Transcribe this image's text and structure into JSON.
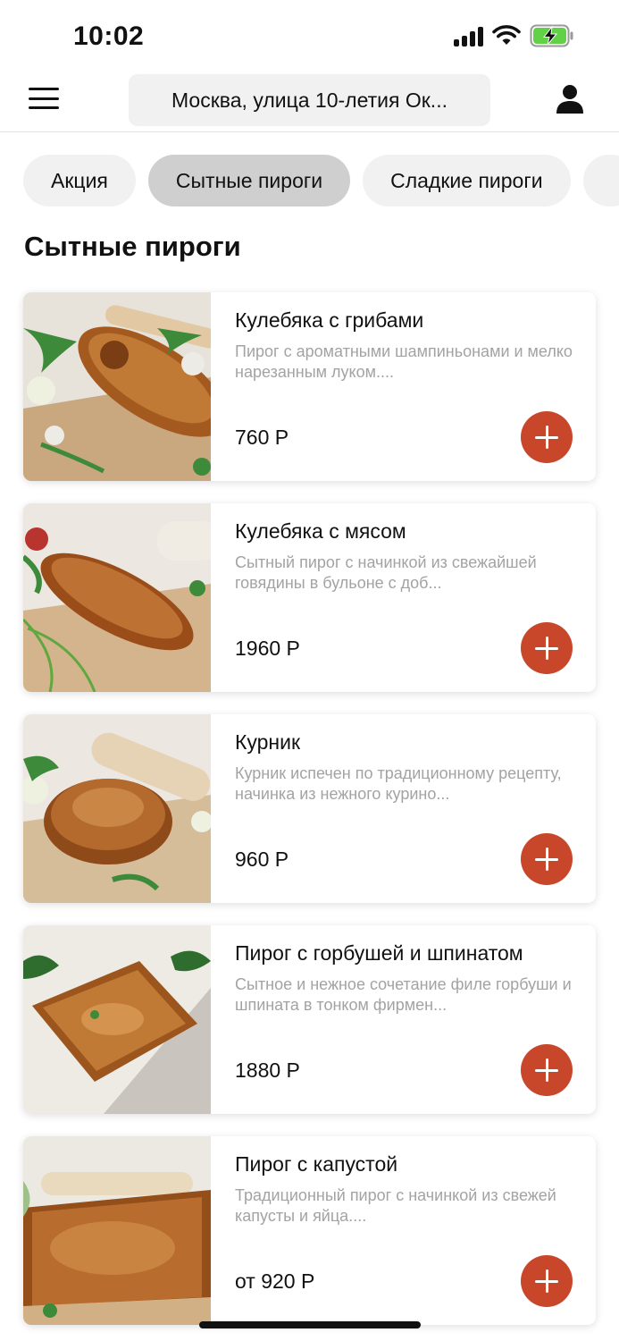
{
  "status_bar": {
    "time": "10:02"
  },
  "header": {
    "address": "Москва, улица 10-летия Ок..."
  },
  "categories": [
    {
      "label": "Акция",
      "active": false
    },
    {
      "label": "Сытные пироги",
      "active": true
    },
    {
      "label": "Сладкие пироги",
      "active": false
    }
  ],
  "section": {
    "title": "Сытные пироги"
  },
  "products": [
    {
      "name": "Кулебяка с грибами",
      "description": "Пирог с ароматными шампиньонами и мелко нарезанным луком....",
      "price": "760 Р"
    },
    {
      "name": "Кулебяка с мясом",
      "description": "Сытный пирог с начинкой из свежайшей говядины в бульоне с доб...",
      "price": "1960 Р"
    },
    {
      "name": "Курник",
      "description": "Курник испечен по традиционному рецепту, начинка из нежного курино...",
      "price": "960 Р"
    },
    {
      "name": "Пирог с горбушей и шпинатом",
      "description": "Сытное и нежное сочетание филе горбуши и шпината в тонком фирмен...",
      "price": "1880 Р"
    },
    {
      "name": "Пирог с капустой",
      "description": "Традиционный пирог с начинкой из свежей капусты и яйца....",
      "price": "от 920 Р"
    }
  ],
  "colors": {
    "accent": "#c8472a",
    "chip_bg": "#f1f1f1",
    "chip_active_bg": "#cfcfcf",
    "muted_text": "#a3a3a3"
  },
  "icons": {
    "menu": "hamburger-menu-icon",
    "profile": "user-profile-icon",
    "add": "plus-icon"
  }
}
